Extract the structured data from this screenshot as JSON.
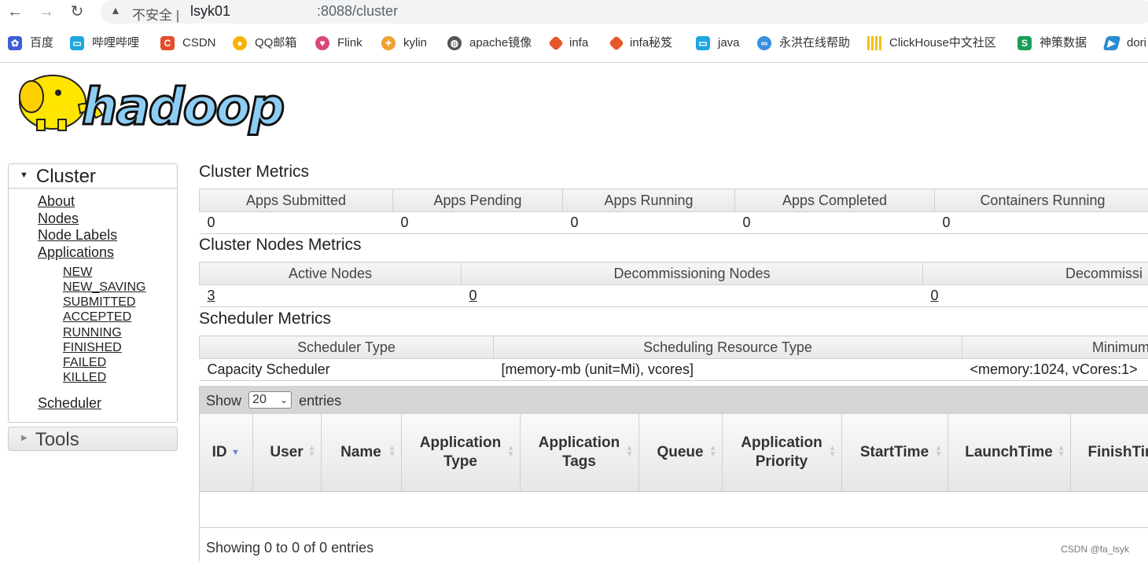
{
  "browser": {
    "back_glyph": "←",
    "forward_glyph": "→",
    "reload_glyph": "↻",
    "warning_glyph": "▲",
    "insecure_label": "不安全 |",
    "url_host": "lsyk01",
    "url_rest": ":8088/cluster",
    "bookmarks": [
      "百度",
      "哔哩哔哩",
      "CSDN",
      "QQ邮箱",
      "Flink",
      "kylin",
      "apache镜像",
      "infa",
      "infa秘笈",
      "java",
      "永洪在线帮助",
      "ClickHouse中文社区",
      "神策数据",
      "dori"
    ],
    "bookmark_icons": [
      "baidu-icon",
      "bilibili-icon",
      "csdn-icon",
      "qq-mail-icon",
      "flink-icon",
      "kylin-icon",
      "globe-icon",
      "infa-icon",
      "infa-icon",
      "bilibili-icon",
      "yonghong-icon",
      "clickhouse-icon",
      "sensors-icon",
      "doris-icon"
    ]
  },
  "logo": {
    "text": "hadoop"
  },
  "nav": {
    "cluster_title": "Cluster",
    "links": [
      "About",
      "Nodes",
      "Node Labels",
      "Applications"
    ],
    "app_states": [
      "NEW",
      "NEW_SAVING",
      "SUBMITTED",
      "ACCEPTED",
      "RUNNING",
      "FINISHED",
      "FAILED",
      "KILLED"
    ],
    "scheduler": "Scheduler",
    "tools_title": "Tools"
  },
  "cluster_metrics": {
    "title": "Cluster Metrics",
    "headers": [
      "Apps Submitted",
      "Apps Pending",
      "Apps Running",
      "Apps Completed",
      "Containers Running"
    ],
    "values": [
      "0",
      "0",
      "0",
      "0",
      "0"
    ]
  },
  "node_metrics": {
    "title": "Cluster Nodes Metrics",
    "headers": [
      "Active Nodes",
      "Decommissioning Nodes",
      "Decommissi"
    ],
    "values": [
      "3",
      "0",
      "0"
    ]
  },
  "scheduler_metrics": {
    "title": "Scheduler Metrics",
    "headers": [
      "Scheduler Type",
      "Scheduling Resource Type",
      "Minimum"
    ],
    "values": [
      "Capacity Scheduler",
      "[memory-mb (unit=Mi), vcores]",
      "<memory:1024, vCores:1>"
    ]
  },
  "apps": {
    "show_label": "Show",
    "page_size": "20",
    "entries_label": "entries",
    "columns": [
      "ID",
      "User",
      "Name",
      "Application Type",
      "Application Tags",
      "Queue",
      "Application Priority",
      "StartTime",
      "LaunchTime",
      "FinishTime"
    ],
    "info": "Showing 0 to 0 of 0 entries"
  },
  "watermark": "CSDN @fa_lsyk"
}
